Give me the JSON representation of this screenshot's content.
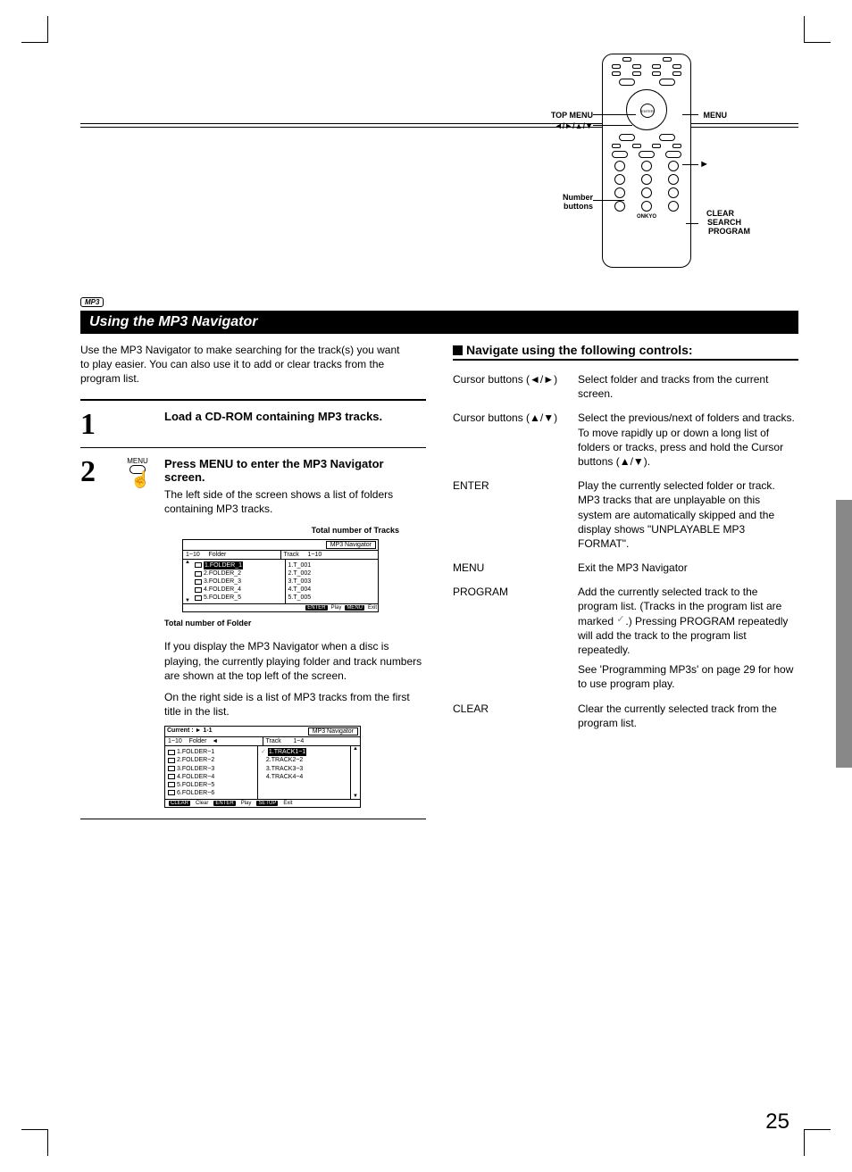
{
  "remote_labels": {
    "top_menu": "TOP MENU",
    "arrows": "◄/►/▲/▼",
    "menu": "MENU",
    "play": "►",
    "number": "Number",
    "buttons": "buttons",
    "clear": "CLEAR",
    "search": "SEARCH",
    "program": "PROGRAM"
  },
  "badge": "MP3",
  "title_bar": "Using the MP3 Navigator",
  "intro": "Use the MP3 Navigator to make searching for the track(s) you want to play easier. You can also use it to add or clear tracks from the program list.",
  "steps": {
    "s1": {
      "num": "1",
      "title": "Load a CD-ROM containing MP3 tracks."
    },
    "s2": {
      "num": "2",
      "icon_label": "MENU",
      "title": "Press MENU to enter the MP3 Navigator screen.",
      "text1": "The left side of the screen shows a list of folders containing MP3 tracks.",
      "label_tracks": "Total number of Tracks",
      "label_folder": "Total number of Folder",
      "text2": "If you display the MP3 Navigator when a disc is playing, the currently playing folder and track numbers are shown at the top left of the screen.",
      "text3": "On the right side is a list of MP3 tracks from the first title in the list."
    }
  },
  "screen1": {
    "tab": "MP3 Navigator",
    "h_left_a": "1~10",
    "h_left_b": "Folder",
    "h_right_a": "Track",
    "h_right_b": "1~10",
    "folders": [
      "1.FOLDER_1",
      "2.FOLDER_2",
      "3.FOLDER_3",
      "4.FOLDER_4",
      "5.FOLDER_5"
    ],
    "tracks": [
      "1.T_001",
      "2.T_002",
      "3.T_003",
      "4.T_004",
      "5.T_005"
    ],
    "f_enter": "ENTER",
    "f_play": "Play",
    "f_menu": "MENU",
    "f_exit": "Exit"
  },
  "screen2": {
    "current": "Current :    ►  1-1",
    "tab": "MP3 Navigator",
    "h_left_a": "1~10",
    "h_left_b": "Folder",
    "h_left_arrow": "◄",
    "h_right_a": "Track",
    "h_right_b": "1~4",
    "folders": [
      "1.FOLDER~1",
      "2.FOLDER~2",
      "3.FOLDER~3",
      "4.FOLDER~4",
      "5.FOLDER~5",
      "6.FOLDER~6"
    ],
    "tracks": [
      "1.TRACK1~1",
      "2.TRACK2~2",
      "3.TRACK3~3",
      "4.TRACK4~4"
    ],
    "f_clear": "CLEAR",
    "f_clear2": "Clear",
    "f_enter": "ENTER",
    "f_play": "Play",
    "f_setup": "SETUP",
    "f_exit": "Exit"
  },
  "subhead": "Navigate using the following controls:",
  "controls": {
    "r1k": "Cursor buttons (◄/►)",
    "r1v": "Select folder and tracks from the current screen.",
    "r2k": "Cursor buttons (▲/▼)",
    "r2v": "Select the previous/next of folders and tracks. To move rapidly up or down a long list of folders or tracks, press and hold the Cursor buttons (▲/▼).",
    "r3k": "ENTER",
    "r3v": "Play the currently selected folder or track. MP3 tracks that are unplayable on this system are automatically skipped and the display shows \"UNPLAYABLE MP3 FORMAT\".",
    "r4k": "MENU",
    "r4v": "Exit the MP3 Navigator",
    "r5k": "PROGRAM",
    "r5v_a": "Add the currently selected track to the program list. (Tracks in the program list are  marked ",
    "r5v_b": ".) Pressing PROGRAM repeatedly will add the track to the program list repeatedly.",
    "r5v_c": "See 'Programming MP3s' on page 29 for how to use program play.",
    "r6k": "CLEAR",
    "r6v": "Clear the currently selected track from the program list."
  },
  "page_num": "25"
}
